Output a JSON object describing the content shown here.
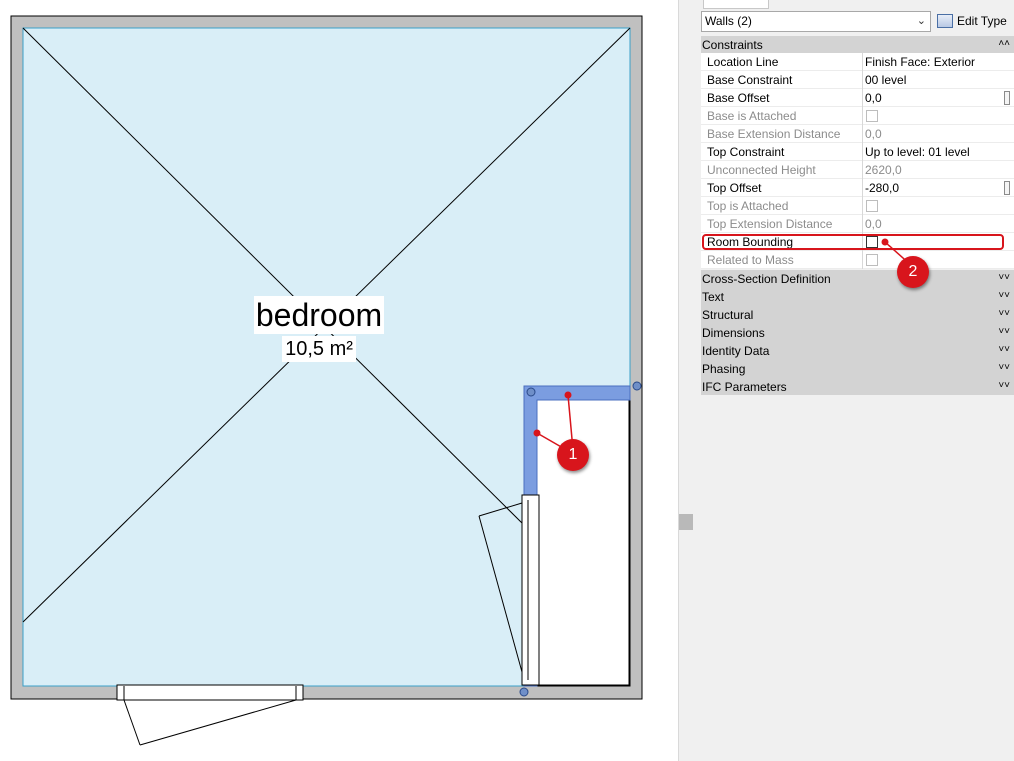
{
  "canvas": {
    "room_name": "bedroom",
    "room_area": "10,5 m²",
    "callouts": [
      "1",
      "2"
    ],
    "colors": {
      "room_fill": "#d9eef7",
      "wall": "#c0c0c0",
      "selected_wall": "#7b9de0",
      "callout": "#d8151c"
    }
  },
  "properties": {
    "type_selector": "Walls (2)",
    "edit_type_label": "Edit Type",
    "constraints_label": "Constraints",
    "rows": [
      {
        "name": "Location Line",
        "value": "Finish Face: Exterior"
      },
      {
        "name": "Base Constraint",
        "value": "00 level"
      },
      {
        "name": "Base Offset",
        "value": "0,0"
      },
      {
        "name": "Base is Attached",
        "value": ""
      },
      {
        "name": "Base Extension Distance",
        "value": "0,0"
      },
      {
        "name": "Top Constraint",
        "value": "Up to level: 01 level"
      },
      {
        "name": "Unconnected Height",
        "value": "2620,0"
      },
      {
        "name": "Top Offset",
        "value": "-280,0"
      },
      {
        "name": "Top is Attached",
        "value": ""
      },
      {
        "name": "Top Extension Distance",
        "value": "0,0"
      },
      {
        "name": "Room Bounding",
        "value": ""
      },
      {
        "name": "Related to Mass",
        "value": ""
      }
    ],
    "groups": [
      "Cross-Section Definition",
      "Text",
      "Structural",
      "Dimensions",
      "Identity Data",
      "Phasing",
      "IFC Parameters"
    ]
  }
}
